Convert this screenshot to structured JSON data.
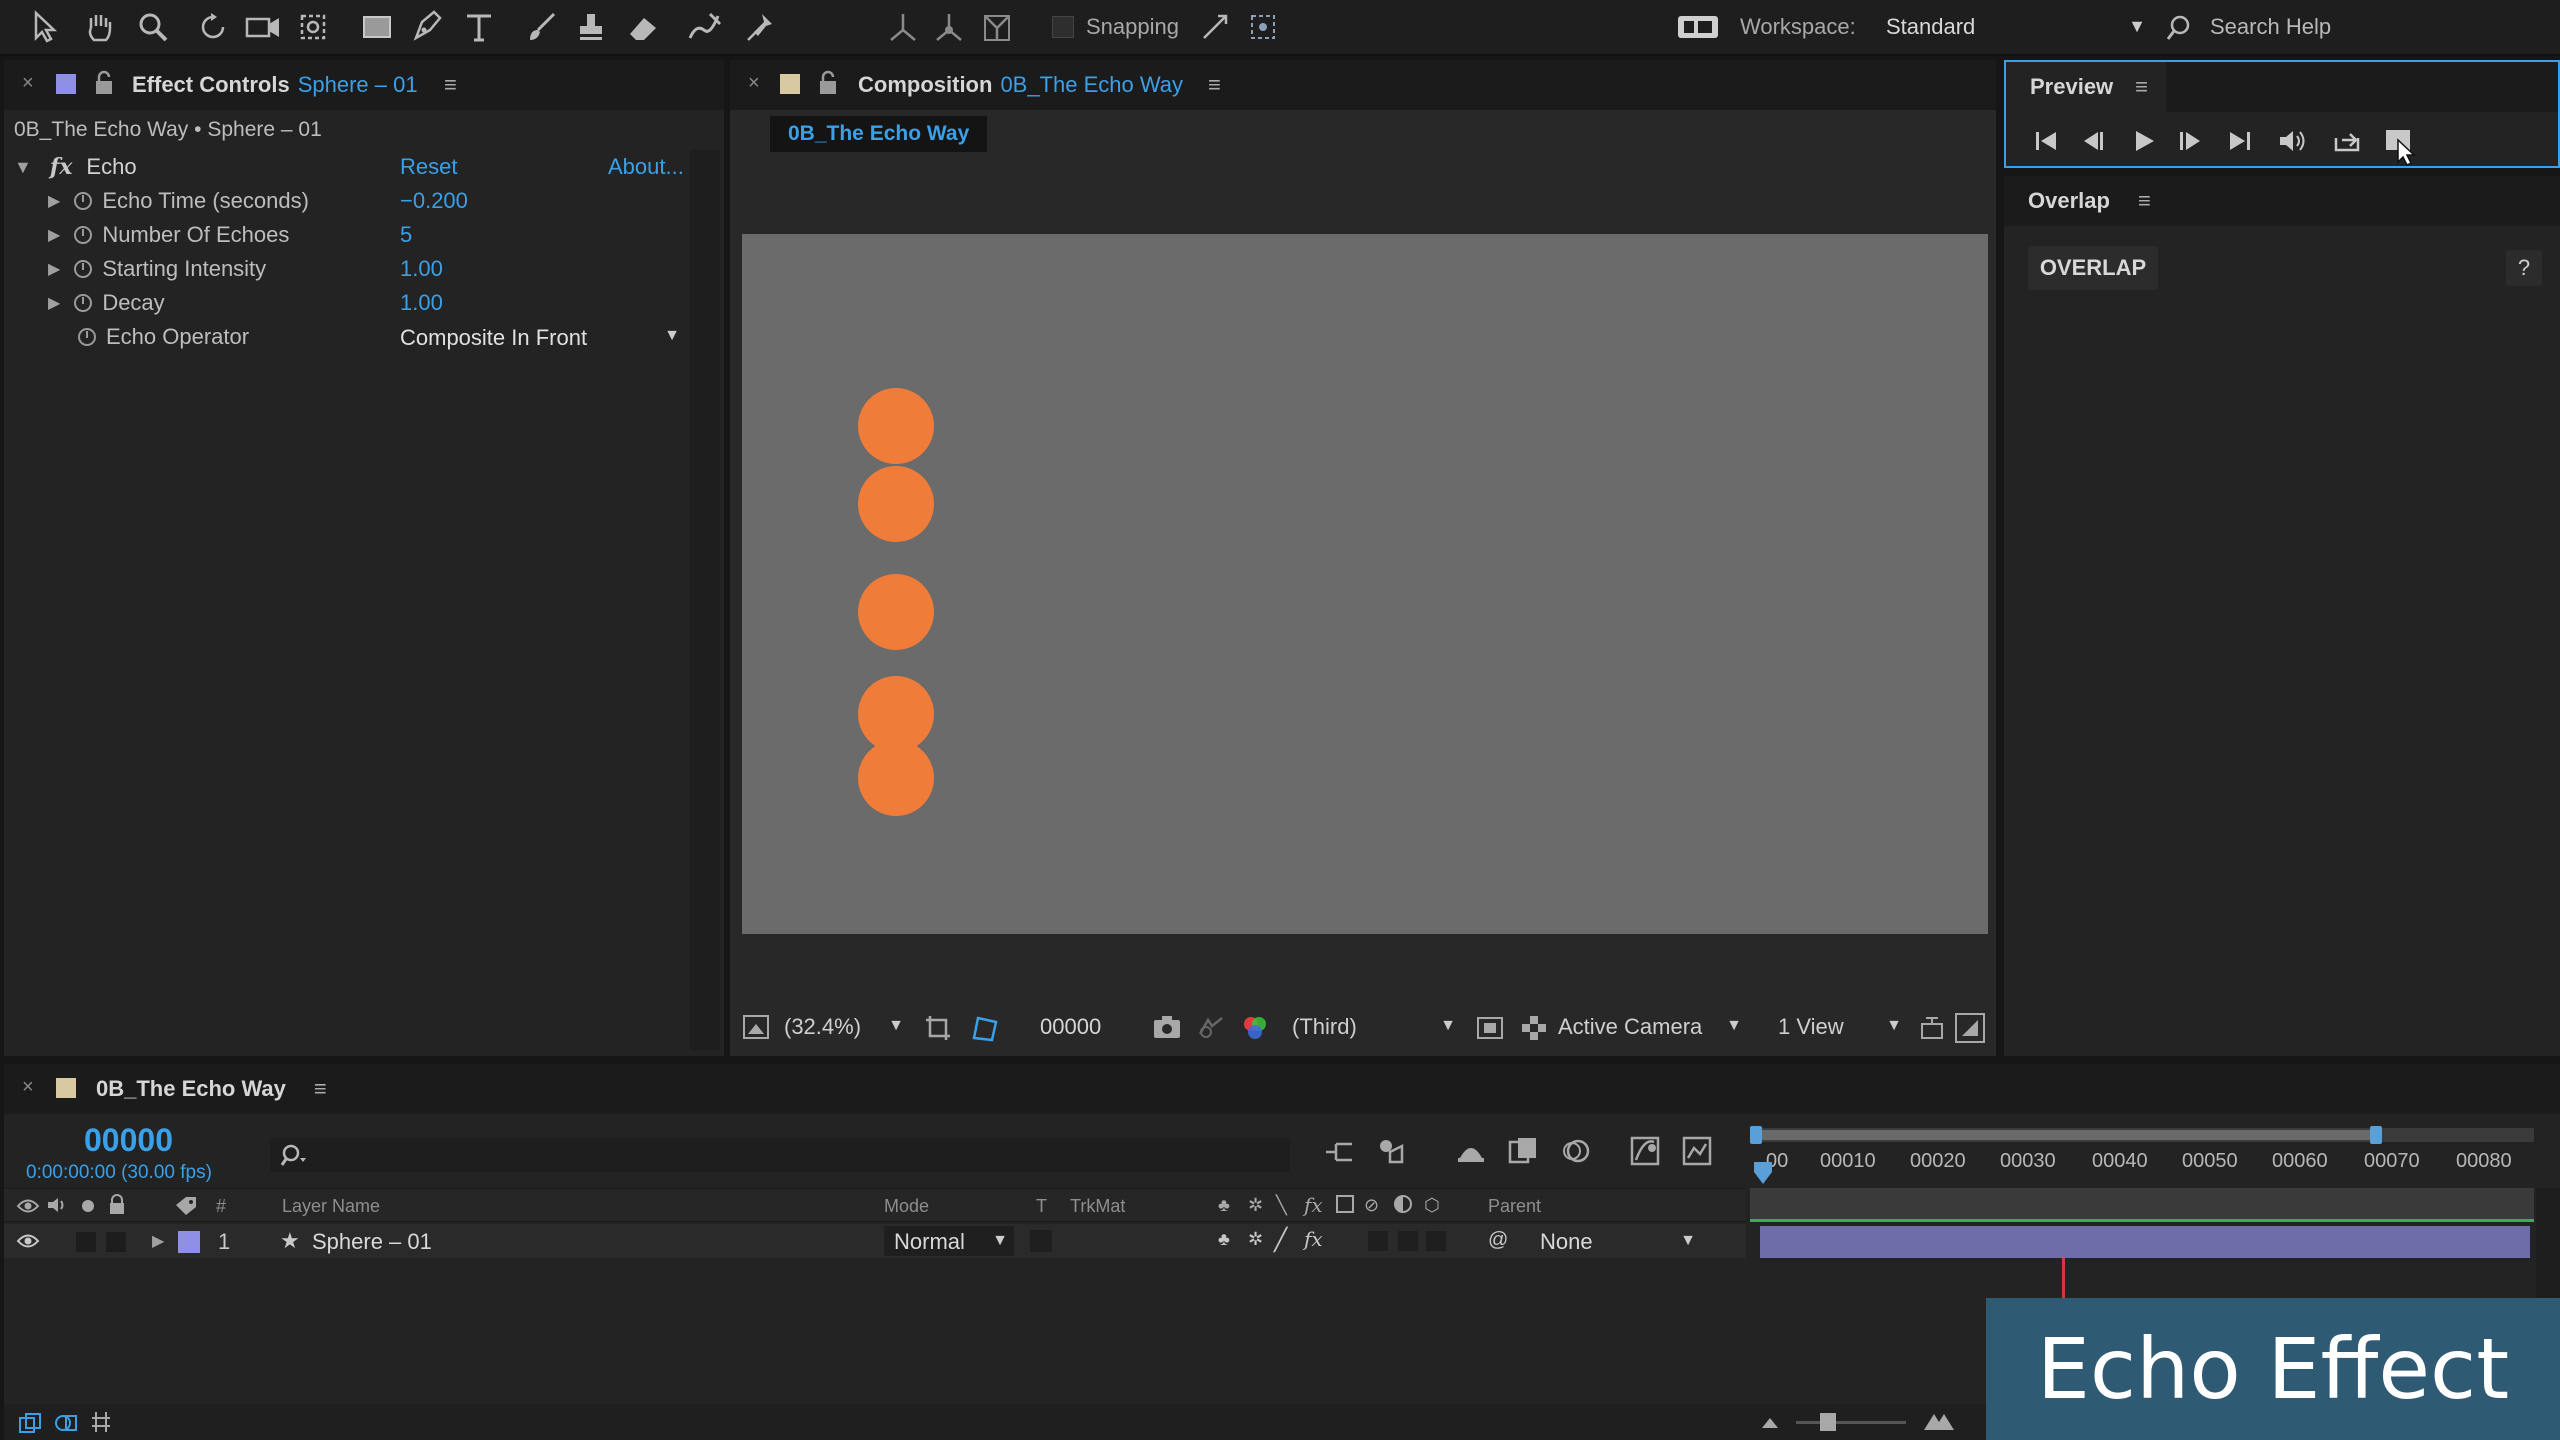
{
  "toolbar": {
    "snapping_label": "Snapping",
    "workspace_label": "Workspace:",
    "workspace_value": "Standard",
    "search_placeholder": "Search Help"
  },
  "effect_controls": {
    "tab_prefix": "Effect Controls",
    "tab_layer": "Sphere – 01",
    "breadcrumb": "0B_The Echo Way • Sphere – 01",
    "effect_name": "Echo",
    "reset_label": "Reset",
    "about_label": "About...",
    "params": [
      {
        "name": "Echo Time (seconds)",
        "value": "−0.200"
      },
      {
        "name": "Number Of Echoes",
        "value": "5"
      },
      {
        "name": "Starting Intensity",
        "value": "1.00"
      },
      {
        "name": "Decay",
        "value": "1.00"
      },
      {
        "name": "Echo Operator",
        "value": "Composite In Front"
      }
    ]
  },
  "composition": {
    "tab_prefix": "Composition",
    "tab_name": "0B_The Echo Way",
    "flow_label": "0B_The Echo Way",
    "zoom": "(32.4%)",
    "timecode": "00000",
    "resolution": "(Third)",
    "camera": "Active Camera",
    "views": "1 View",
    "circle_color": "#f07c3a"
  },
  "preview": {
    "tab": "Preview"
  },
  "overlap": {
    "tab": "Overlap",
    "title": "OVERLAP",
    "help": "?"
  },
  "timeline": {
    "tab": "0B_The Echo Way",
    "timecode": "00000",
    "timecode_sub": "0:00:00:00 (30.00 fps)",
    "columns": {
      "number": "#",
      "layer_name": "Layer Name",
      "mode": "Mode",
      "t": "T",
      "trkmat": "TrkMat",
      "parent": "Parent"
    },
    "layers": [
      {
        "index": "1",
        "name": "Sphere – 01",
        "mode": "Normal",
        "parent": "None",
        "color": "#8f8fe8"
      }
    ],
    "ruler": [
      "00",
      "00010",
      "00020",
      "00030",
      "00040",
      "00050",
      "00060",
      "00070",
      "00080"
    ]
  },
  "banner": {
    "text": "Echo Effect",
    "color": "#2f5a73"
  }
}
